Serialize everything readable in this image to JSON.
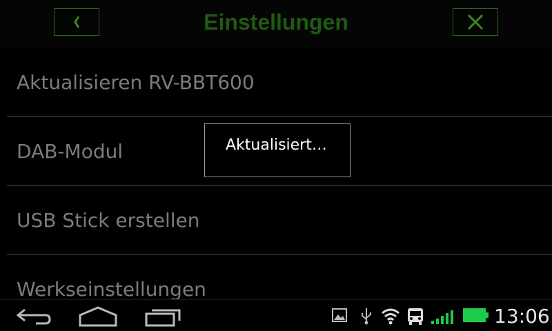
{
  "header": {
    "title": "Einstellungen",
    "back_icon": "back-chevron-icon",
    "close_icon": "close-icon"
  },
  "settings_list": [
    {
      "label": "Aktualisieren RV-BBT600"
    },
    {
      "label": "DAB-Modul"
    },
    {
      "label": "USB Stick erstellen"
    },
    {
      "label": "Werkseinstellungen"
    }
  ],
  "popup": {
    "message": "Aktualisiert…"
  },
  "navbar": {
    "icons": [
      "back-icon",
      "home-icon",
      "recent-apps-icon"
    ]
  },
  "status_bar": {
    "icons": [
      "image-notification-icon",
      "usb-icon",
      "wifi-icon",
      "bus-icon",
      "signal-icon",
      "battery-icon"
    ],
    "time": "13:06"
  },
  "colors": {
    "accent_green": "#2e6a1c",
    "title_green": "#1f5a12",
    "battery_green": "#1fc94a"
  }
}
